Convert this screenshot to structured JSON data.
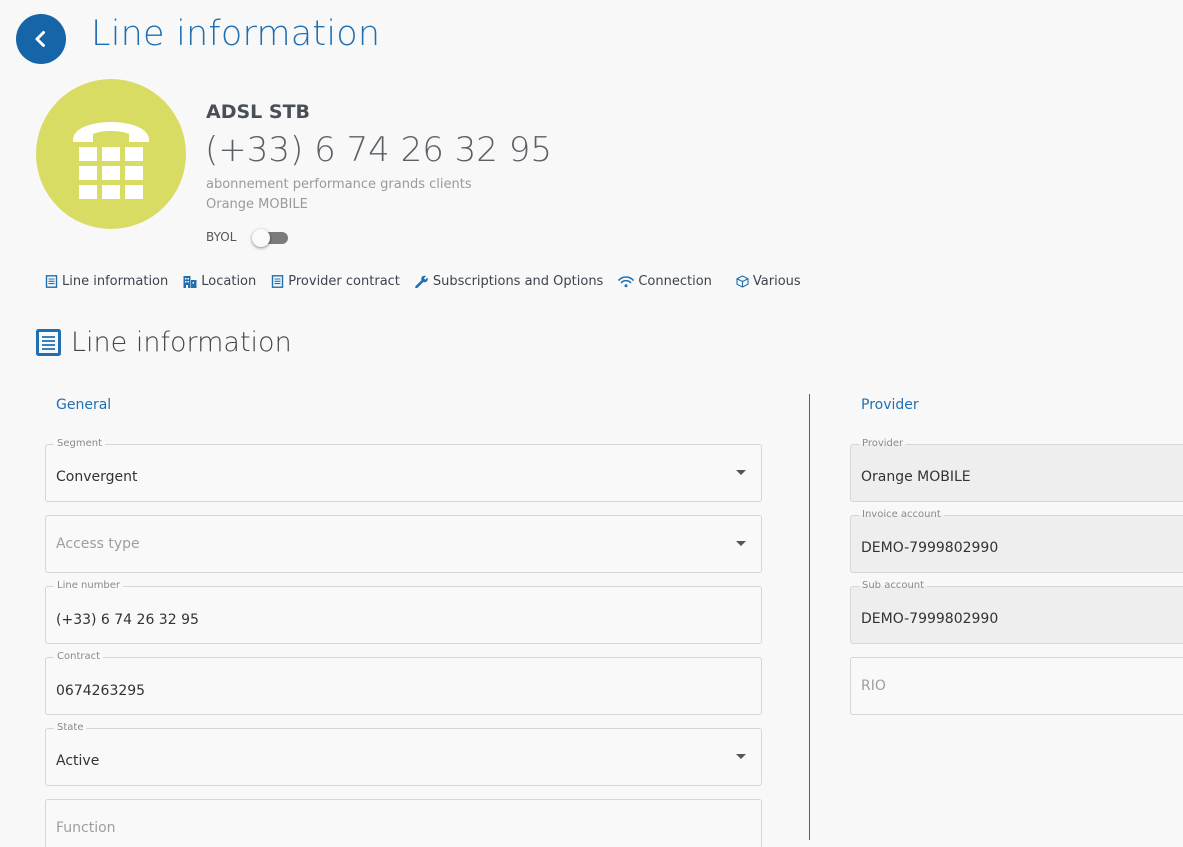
{
  "header": {
    "title": "Line information"
  },
  "line": {
    "name": "ADSL STB",
    "number": "(+33) 6 74 26 32 95",
    "plan": "abonnement performance grands clients",
    "provider": "Orange MOBILE",
    "byol_label": "BYOL",
    "byol_enabled": false
  },
  "tabs": [
    {
      "label": "Line information",
      "icon": "document-icon"
    },
    {
      "label": "Location",
      "icon": "building-icon"
    },
    {
      "label": "Provider contract",
      "icon": "document-icon"
    },
    {
      "label": "Subscriptions and Options",
      "icon": "wrench-icon"
    },
    {
      "label": "Connection",
      "icon": "wifi-icon"
    },
    {
      "label": "Various",
      "icon": "cube-icon"
    }
  ],
  "section": {
    "title": "Line information",
    "icon": "document-icon"
  },
  "general": {
    "label": "General",
    "segment": {
      "label": "Segment",
      "value": "Convergent"
    },
    "access_type": {
      "placeholder": "Access type"
    },
    "line_number": {
      "label": "Line number",
      "value": "(+33) 6 74 26 32 95"
    },
    "contract": {
      "label": "Contract",
      "value": "0674263295"
    },
    "state": {
      "label": "State",
      "value": "Active"
    },
    "function": {
      "placeholder": "Function"
    }
  },
  "provider_group": {
    "label": "Provider",
    "provider": {
      "label": "Provider",
      "value": "Orange MOBILE"
    },
    "invoice_account": {
      "label": "Invoice account",
      "value": "DEMO-7999802990"
    },
    "sub_account": {
      "label": "Sub account",
      "value": "DEMO-7999802990"
    },
    "rio": {
      "placeholder": "RIO"
    }
  },
  "colors": {
    "accent": "#1f6fb2",
    "avatar": "#d9dc62",
    "back_button": "#1565a8"
  }
}
